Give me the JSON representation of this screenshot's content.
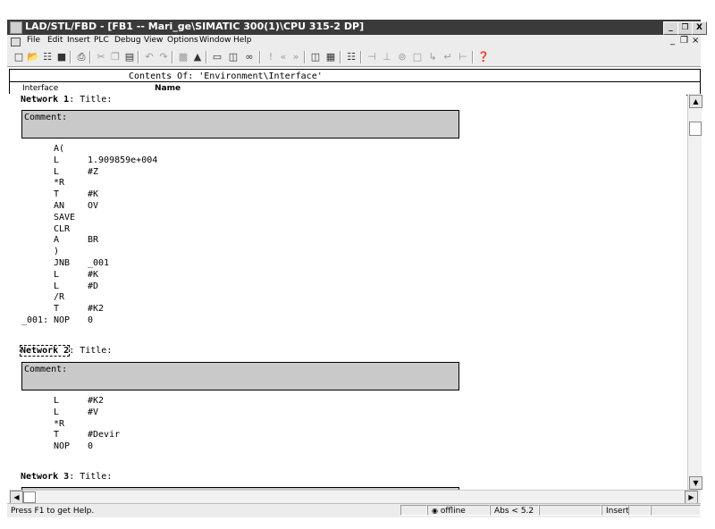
{
  "window": {
    "title": "LAD/STL/FBD  - [FB1 -- Mari_ge\\SIMATIC 300(1)\\CPU 315-2 DP]",
    "minimize": "_",
    "restore": "❐",
    "close": "X"
  },
  "menu": {
    "items": [
      "File",
      "Edit",
      "Insert",
      "PLC",
      "Debug",
      "View",
      "Options",
      "Window",
      "Help"
    ],
    "mdi_min": "_",
    "mdi_restore": "❐",
    "mdi_close": "×"
  },
  "toolbar": {
    "icons": [
      "new-icon",
      "open-icon",
      "accessible-nodes-icon",
      "save-icon",
      "print-icon",
      "cut-icon",
      "copy-icon",
      "paste-icon",
      "undo-icon",
      "redo-icon",
      "load-icon",
      "monitor-icon",
      "block-icon",
      "download-icon",
      "online-icon",
      "go-to-icon",
      "prev-icon",
      "next-icon",
      "overview-icon",
      "details-icon",
      "address-icon",
      "no-contact-icon",
      "nc-contact-icon",
      "coil-icon",
      "empty-box-icon",
      "branch-open-icon",
      "branch-close-icon",
      "help-cursor-icon"
    ]
  },
  "interface_panel": {
    "contents_label": "Contents Of: 'Environment\\Interface'",
    "tree_label": "Interface",
    "name_column": "Name"
  },
  "networks": [
    {
      "label": "Network 1",
      "title": ": Title:",
      "comment": "Comment:",
      "code": [
        {
          "label": "",
          "op": "A(",
          "arg": ""
        },
        {
          "label": "",
          "op": "L",
          "arg": "1.909859e+004"
        },
        {
          "label": "",
          "op": "L",
          "arg": "#Z"
        },
        {
          "label": "",
          "op": "*R",
          "arg": ""
        },
        {
          "label": "",
          "op": "T",
          "arg": "#K"
        },
        {
          "label": "",
          "op": "AN",
          "arg": "OV"
        },
        {
          "label": "",
          "op": "SAVE",
          "arg": ""
        },
        {
          "label": "",
          "op": "CLR",
          "arg": ""
        },
        {
          "label": "",
          "op": "A",
          "arg": "BR"
        },
        {
          "label": "",
          "op": ")",
          "arg": ""
        },
        {
          "label": "",
          "op": "JNB",
          "arg": "_001"
        },
        {
          "label": "",
          "op": "L",
          "arg": "#K"
        },
        {
          "label": "",
          "op": "L",
          "arg": "#D"
        },
        {
          "label": "",
          "op": "/R",
          "arg": ""
        },
        {
          "label": "",
          "op": "T",
          "arg": "#K2"
        },
        {
          "label": "_001:",
          "op": "NOP",
          "arg": "0"
        }
      ]
    },
    {
      "label": "Network 2",
      "title": ": Title:",
      "comment": "Comment:",
      "code": [
        {
          "label": "",
          "op": "L",
          "arg": "#K2"
        },
        {
          "label": "",
          "op": "L",
          "arg": "#V"
        },
        {
          "label": "",
          "op": "*R",
          "arg": ""
        },
        {
          "label": "",
          "op": "T",
          "arg": "#Devir"
        },
        {
          "label": "",
          "op": "NOP",
          "arg": "0"
        }
      ]
    },
    {
      "label": "Network 3",
      "title": ": Title:"
    }
  ],
  "status": {
    "help": "Press F1 to get Help.",
    "online_state": "offline",
    "abs": "Abs < 5.2",
    "mode": "Insert"
  }
}
